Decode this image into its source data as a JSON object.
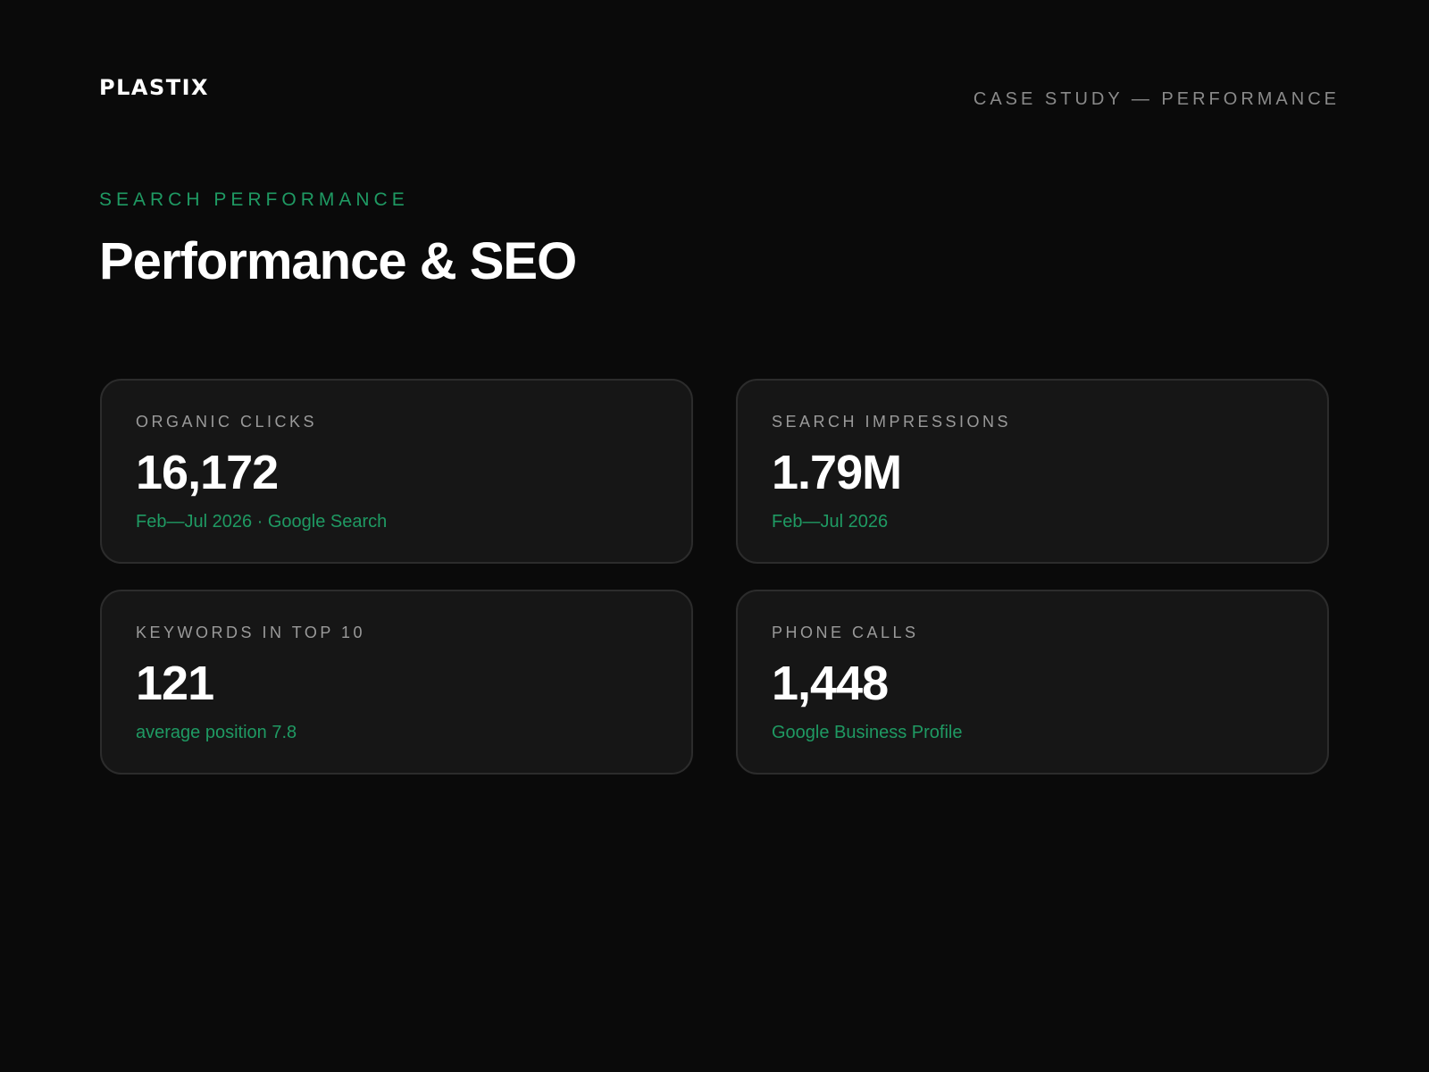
{
  "brand": {
    "logo": "PLASTIX"
  },
  "header": {
    "section_label": "CASE STUDY — PERFORMANCE"
  },
  "hero": {
    "eyebrow": "SEARCH PERFORMANCE",
    "title": "Performance & SEO"
  },
  "metrics": [
    {
      "label": "ORGANIC CLICKS",
      "value": "16,172",
      "note": "Feb—Jul 2026 · Google Search"
    },
    {
      "label": "SEARCH IMPRESSIONS",
      "value": "1.79M",
      "note": "Feb—Jul 2026"
    },
    {
      "label": "KEYWORDS IN TOP 10",
      "value": "121",
      "note": "average position 7.8"
    },
    {
      "label": "PHONE CALLS",
      "value": "1,448",
      "note": "Google Business Profile"
    }
  ],
  "colors": {
    "background": "#0a0a0a",
    "card_background": "#161616",
    "card_border": "#2c2c2c",
    "accent": "#1f9a63",
    "muted": "#8a8a8a",
    "text": "#ffffff"
  }
}
